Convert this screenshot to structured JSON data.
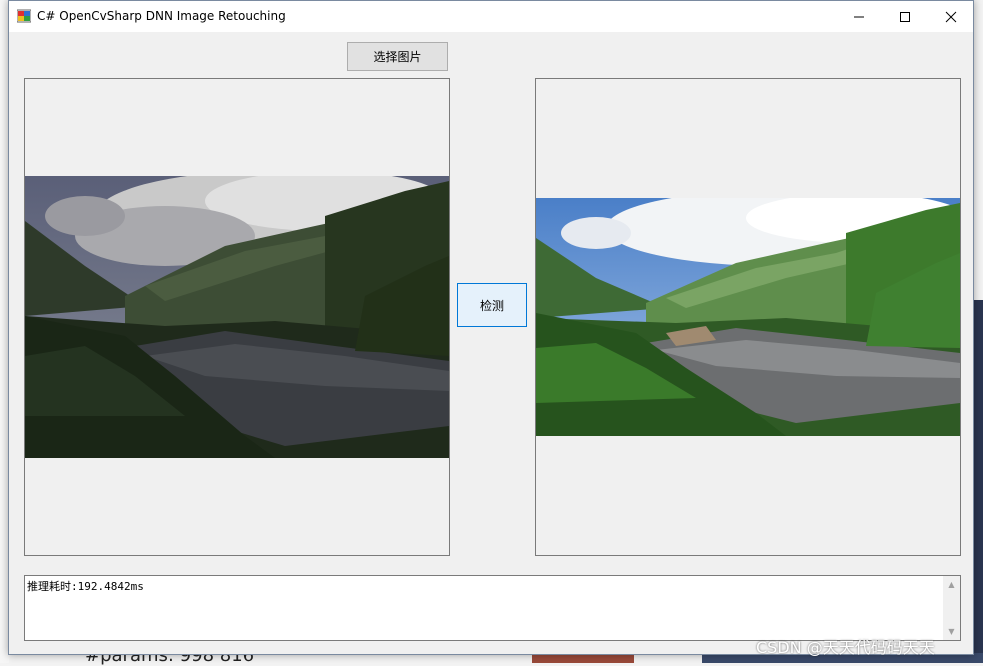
{
  "window": {
    "title": "C# OpenCvSharp DNN Image Retouching",
    "minimize_glyph": "—",
    "maximize_glyph": "☐",
    "close_glyph": "✕"
  },
  "toolbar": {
    "select_image_label": "选择图片",
    "detect_label": "检测"
  },
  "images": {
    "input_icon": "landscape-photo-dark",
    "output_icon": "landscape-photo-retouched"
  },
  "output": {
    "text": "推理耗时:192.4842ms"
  },
  "background": {
    "bottom_text": "#params: 998 816"
  },
  "watermark": "CSDN @天天代码码天天",
  "colors": {
    "accent": "#0078d7",
    "button_bg": "#e1e1e1",
    "window_bg": "#f0f0f0"
  }
}
